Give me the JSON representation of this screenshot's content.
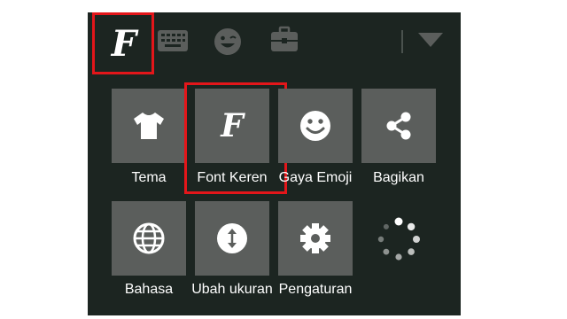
{
  "toolbar": {
    "font_glyph": "F",
    "icons": [
      "font-icon",
      "keyboard-icon",
      "emoji-icon",
      "briefcase-icon",
      "collapse-triangle-icon"
    ]
  },
  "menu": {
    "items": [
      {
        "label": "Tema",
        "icon": "tshirt-icon"
      },
      {
        "label": "Font Keren",
        "icon": "font-icon",
        "glyph": "F"
      },
      {
        "label": "Gaya Emoji",
        "icon": "smiley-icon"
      },
      {
        "label": "Bagikan",
        "icon": "share-icon"
      },
      {
        "label": "Bahasa",
        "icon": "globe-icon"
      },
      {
        "label": "Ubah ukuran",
        "icon": "resize-icon"
      },
      {
        "label": "Pengaturan",
        "icon": "gear-icon"
      },
      {
        "label": "",
        "icon": "loading-spinner-icon"
      }
    ]
  },
  "colors": {
    "panel_bg": "#1c2521",
    "tile_bg": "#5b5e5c",
    "highlight": "#e3161a",
    "text": "#ffffff"
  }
}
